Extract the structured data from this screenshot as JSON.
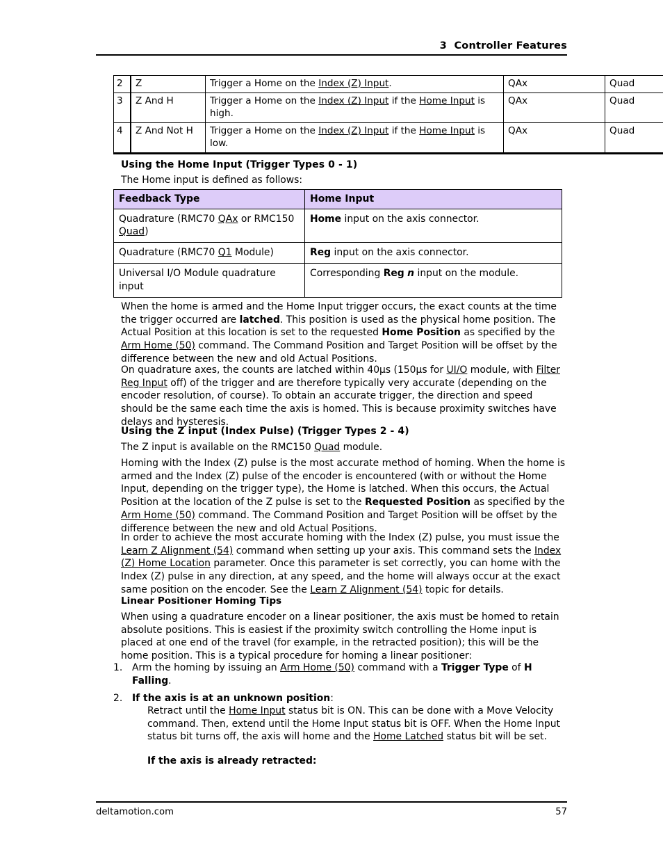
{
  "header": {
    "title": "3  Controller Features"
  },
  "trigger_table": {
    "rows": [
      {
        "num": "2",
        "name": "Z",
        "desc_pre": "Trigger a Home on the ",
        "desc_link1": "Index (Z) Input",
        "desc_mid": ".",
        "desc_link2": "",
        "desc_post": "",
        "fb1": "QAx",
        "fb2": "Quad"
      },
      {
        "num": "3",
        "name": "Z And H",
        "desc_pre": "Trigger a Home on the ",
        "desc_link1": "Index (Z) Input",
        "desc_mid": " if the ",
        "desc_link2": "Home Input",
        "desc_post": " is high.",
        "fb1": "QAx",
        "fb2": "Quad"
      },
      {
        "num": "4",
        "name": "Z And Not H",
        "desc_pre": "Trigger a Home on the ",
        "desc_link1": "Index (Z) Input",
        "desc_mid": " if the ",
        "desc_link2": "Home Input",
        "desc_post": " is low.",
        "fb1": "QAx",
        "fb2": "Quad"
      }
    ]
  },
  "section_home_input": {
    "heading": "Using the Home Input (Trigger Types 0 - 1)",
    "intro": "The Home input is defined as follows:",
    "table": {
      "headers": [
        "Feedback Type",
        "Home Input"
      ],
      "rows": [
        {
          "fb_pre": "Quadrature (RMC70 ",
          "fb_link1": "QAx",
          "fb_mid": " or RMC150 ",
          "fb_link2": "Quad",
          "fb_post": ")",
          "hi_bold": "Home",
          "hi_rest": " input on the axis connector."
        },
        {
          "fb_pre": "Quadrature (RMC70 ",
          "fb_link1": "Q1",
          "fb_mid": " Module)",
          "fb_link2": "",
          "fb_post": "",
          "hi_bold": "Reg",
          "hi_rest": " input on the axis connector."
        },
        {
          "fb_pre": "Universal I/O Module quadrature input",
          "fb_link1": "",
          "fb_mid": "",
          "fb_link2": "",
          "fb_post": "",
          "hi_bold": "",
          "hi_rest": ""
        }
      ],
      "row3_home_input": {
        "pre": "Corresponding ",
        "bold": "Reg",
        "bold_italic": "n",
        "post": " input on the module."
      }
    },
    "para1": {
      "t1": "When the home is armed and the Home Input trigger occurs, the exact counts at the time the trigger occurred are ",
      "b1": "latched",
      "t2": ". This position is used as the physical home position. The Actual Position at this location is set to the requested ",
      "b2": "Home Position",
      "t3": " as specified by the ",
      "link1": "Arm Home (50)",
      "t4": " command. The Command Position and Target Position will be offset by the difference between the new and old Actual Positions."
    },
    "para2": {
      "t1": "On quadrature axes, the counts are latched within 40µs (150µs for ",
      "link1": "UI/O",
      "t2": " module, with ",
      "link2": "Filter Reg Input",
      "t3": " off) of the trigger and are therefore typically very accurate (depending on the encoder resolution, of course). To obtain an accurate trigger, the direction and speed should be the same each time the axis is homed. This is because proximity switches have delays and hysteresis."
    }
  },
  "section_z_input": {
    "heading": "Using the Z input (Index Pulse) (Trigger Types 2 - 4)",
    "intro_pre": "The Z input is available on the RMC150 ",
    "intro_link": "Quad",
    "intro_post": " module.",
    "para1": {
      "t1": "Homing with the Index (Z) pulse is the most accurate method of homing. When the home is armed and the Index (Z) pulse of the encoder is encountered (with or without the Home Input, depending on the trigger type), the Home is latched. When this occurs, the Actual Position at the location of the Z pulse is set to the ",
      "b1": "Requested Position",
      "t2": " as specified by the ",
      "link1": "Arm Home (50)",
      "t3": " command. The Command Position and Target Position will be offset by the difference between the new and old Actual Positions."
    },
    "para2": {
      "t1": "In order to achieve the most accurate homing with the Index (Z) pulse, you must issue the ",
      "link1": "Learn Z Alignment (54)",
      "t2": " command when setting up your axis. This command sets the ",
      "link2": "Index (Z) Home Location",
      "t3": " parameter. Once this parameter is set correctly, you can home with the Index (Z) pulse in any direction, at any speed, and the home will always occur at the exact same position on the encoder. See the ",
      "link3": "Learn Z Alignment (54)",
      "t4": " topic for details."
    }
  },
  "section_linear": {
    "heading": "Linear Positioner Homing Tips",
    "para1": "When using a quadrature encoder on a linear positioner, the axis must be homed to retain absolute positions. This is easiest if the proximity switch controlling the Home input is placed at one end of the travel (for example, in the retracted position); this will be the home position. This is a typical procedure for homing a linear positioner:",
    "list": [
      {
        "marker": "1.",
        "t1": "Arm the homing by issuing an ",
        "link1": "Arm Home (50)",
        "t2": " command with a ",
        "b1": "Trigger Type",
        "t3": " of ",
        "b2": "H Falling",
        "t4": "."
      },
      {
        "marker": "2.",
        "b1": "If the axis is at an unknown position",
        "t1": ":"
      }
    ],
    "sub_para": {
      "t1": "Retract until the ",
      "link1": "Home Input",
      "t2": " status bit is ON. This can be done with a Move Velocity command. Then, extend until the Home Input status bit is OFF. When the Home Input status bit turns off, the axis will home and the ",
      "link2": "Home Latched",
      "t3": " status bit will be set."
    },
    "sub_heading": "If the axis is already retracted:"
  },
  "footer": {
    "site": "deltamotion.com",
    "page_number": "57"
  }
}
